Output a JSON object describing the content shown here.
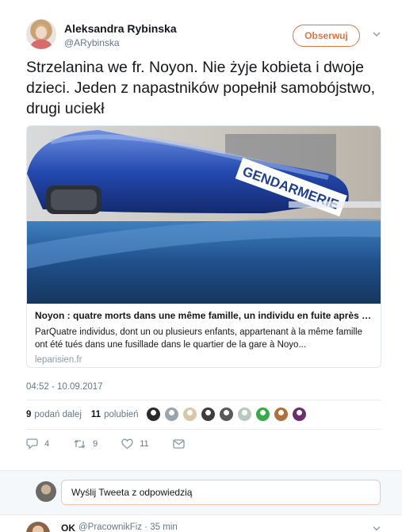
{
  "author": {
    "name": "Aleksandra Rybinska",
    "handle": "@ARybinska",
    "follow_label": "Obserwuj"
  },
  "tweet": {
    "text": "Strzelanina we fr. Noyon. Nie żyje kobieta i dwoje dzieci. Jeden z napastników popełnił samobójstwo, drugi uciekł",
    "timestamp": "04:52 - 10.09.2017"
  },
  "card": {
    "image_label": "GENDARMERIE",
    "title": "Noyon : quatre morts dans une même famille, un individu en fuite après une f...",
    "description": "ParQuatre individus, dont un ou plusieurs enfants, appartenant à la même famille ont été tués dans une fusillade dans le quartier de la gare à Noyo...",
    "domain": "leparisien.fr"
  },
  "stats": {
    "retweets_count": "9",
    "retweets_label": "podań dalej",
    "likes_count": "11",
    "likes_label": "polubień"
  },
  "likers": [
    {
      "color": "#2b2b2b"
    },
    {
      "color": "#9aa4ad"
    },
    {
      "color": "#d9c7a8"
    },
    {
      "color": "#3d3d3d"
    },
    {
      "color": "#5a5a5a"
    },
    {
      "color": "#b9c9c0"
    },
    {
      "color": "#3aa84b"
    },
    {
      "color": "#b0703c"
    },
    {
      "color": "#6b2f6b"
    }
  ],
  "actions": {
    "replies": "4",
    "retweets": "9",
    "likes": "11"
  },
  "reply": {
    "placeholder": "Wyślij Tweeta z odpowiedzią"
  },
  "next_tweet": {
    "name": "OK",
    "meta": "@PracownikFiz · 35 min"
  },
  "colors": {
    "accent": "#e0733f",
    "muted": "#657786",
    "border": "#e1e8ed"
  }
}
